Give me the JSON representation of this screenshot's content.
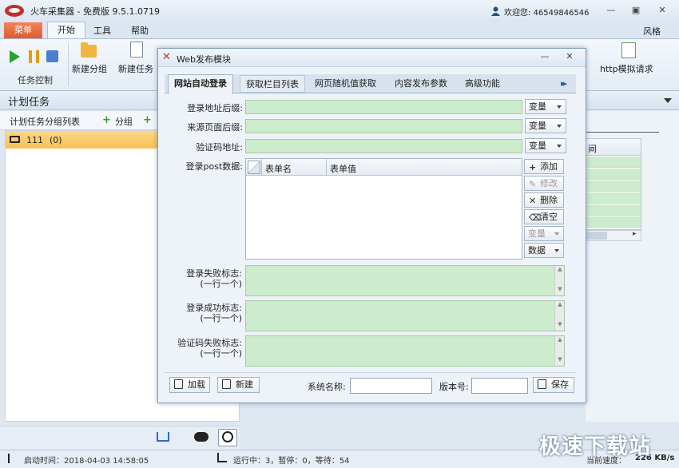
{
  "app": {
    "title": "火车采集器 - 免费版 9.5.1.0719",
    "user_greeting": "欢迎您: 46549846546",
    "style_label": "风格",
    "window_buttons": [
      "minimize",
      "maximize",
      "close"
    ]
  },
  "ribbon": {
    "tabs": [
      {
        "label": "菜单"
      },
      {
        "label": "开始"
      },
      {
        "label": "工具"
      },
      {
        "label": "帮助"
      }
    ],
    "task_control_label": "任务控制",
    "new_group_label": "新建分组",
    "new_task_label": "新建任务",
    "http_label": "http模拟请求"
  },
  "left_panel": {
    "title": "计划任务",
    "group_list_label": "计划任务分组列表",
    "add_group_label": "分组",
    "rows": [
      {
        "name": "111",
        "count": "(0)"
      }
    ]
  },
  "right_panel": {
    "column_header": "间"
  },
  "statusbar": {
    "start_time": "启动时间：2018-04-03 14:58:05",
    "run_status": "运行中：3，暂停：0，等待：54",
    "speed_label": "当前速度：",
    "speed_value": "226 KB/s"
  },
  "watermark": "极速下载站",
  "dialog": {
    "title": "Web发布模块",
    "tabs": [
      {
        "label": "网站自动登录",
        "active": true
      },
      {
        "label": "获取栏目列表"
      },
      {
        "label": "网页随机值获取"
      },
      {
        "label": "内容发布参数"
      },
      {
        "label": "高级功能"
      }
    ],
    "fields": {
      "login_suffix_label": "登录地址后缀:",
      "source_suffix_label": "来源页面后缀:",
      "captcha_label": "验证码地址:",
      "post_label": "登录post数据:",
      "variable_button": "变量"
    },
    "post_table": {
      "columns": [
        "表单名",
        "表单值"
      ]
    },
    "side_buttons": {
      "add": "添加",
      "edit": "修改",
      "delete": "删除",
      "clear": "清空",
      "variable": "变量",
      "data": "数据"
    },
    "flags": {
      "fail_label": "登录失败标志:",
      "success_label": "登录成功标志:",
      "captcha_fail_label": "验证码失败标志:",
      "one_per_line": "(一行一个)"
    },
    "bottom": {
      "load_label": "加载",
      "new_label": "新建",
      "system_name_label": "系统名称:",
      "system_name_value": "",
      "version_label": "版本号:",
      "version_value": "",
      "save_label": "保存"
    }
  },
  "colors": {
    "accent_orange": "#dd5a2c",
    "selected_row": "#f6c257",
    "input_green": "#cdeccd",
    "chrome_blue": "#dbe6f1"
  }
}
